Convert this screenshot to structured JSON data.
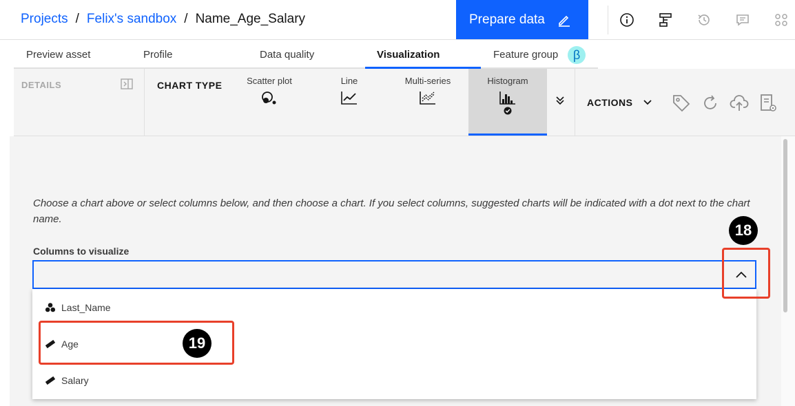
{
  "breadcrumb": {
    "items": [
      "Projects",
      "Felix's sandbox"
    ],
    "separator": "/",
    "current": "Name_Age_Salary"
  },
  "header": {
    "prepare_button": "Prepare data",
    "icons": [
      "info-icon",
      "lineage-icon",
      "history-icon",
      "comment-icon",
      "settings-icon"
    ]
  },
  "tabs": [
    {
      "label": "Preview asset"
    },
    {
      "label": "Profile"
    },
    {
      "label": "Data quality"
    },
    {
      "label": "Visualization",
      "active": true
    },
    {
      "label": "Feature group"
    }
  ],
  "beta_badge": "β",
  "toolbar": {
    "details_label": "DETAILS",
    "chart_type_label": "CHART TYPE",
    "chart_options": [
      {
        "label": "Scatter plot",
        "icon": "scatter-plot-icon"
      },
      {
        "label": "Line",
        "icon": "line-chart-icon"
      },
      {
        "label": "Multi-series",
        "icon": "multi-series-icon"
      },
      {
        "label": "Histogram",
        "icon": "histogram-icon",
        "selected": true
      }
    ],
    "actions_label": "ACTIONS"
  },
  "main": {
    "instruction": "Choose a chart above or select columns below, and then choose a chart. If you select columns, suggested charts will be indicated with a dot next to the chart name.",
    "columns_label": "Columns to visualize",
    "columns_value": "",
    "dropdown_items": [
      {
        "label": "Last_Name",
        "icon": "categorical-icon"
      },
      {
        "label": "Age",
        "icon": "ruler-icon"
      },
      {
        "label": "Salary",
        "icon": "ruler-icon"
      }
    ]
  },
  "annotations": {
    "step_18": "18",
    "step_19": "19",
    "highlight_color": "#e8402a"
  },
  "colors": {
    "accent": "#0f62fe",
    "background": "#f4f4f4"
  }
}
